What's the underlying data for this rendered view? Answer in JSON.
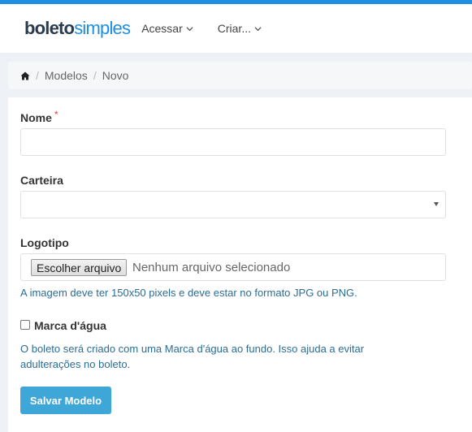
{
  "brand": {
    "logo_part1": "boleto",
    "logo_part2": "simples",
    "accent": "#1e8fe0"
  },
  "nav": {
    "items": [
      {
        "label": "Acessar"
      },
      {
        "label": "Criar..."
      }
    ]
  },
  "breadcrumb": {
    "icon": "home-icon",
    "items": [
      "Modelos",
      "Novo"
    ]
  },
  "form": {
    "nome": {
      "label": "Nome",
      "required_mark": "*",
      "value": ""
    },
    "carteira": {
      "label": "Carteira",
      "selected": ""
    },
    "logotipo": {
      "label": "Logotipo",
      "button": "Escolher arquivo",
      "file_status": "Nenhum arquivo selecionado",
      "help": "A imagem deve ter 150x50 pixels e deve estar no formato JPG ou PNG."
    },
    "marca": {
      "label": "Marca d'água",
      "checked": false,
      "help": "O boleto será criado com uma Marca d'água ao fundo. Isso ajuda a evitar adulterações no boleto."
    },
    "submit": "Salvar Modelo"
  }
}
